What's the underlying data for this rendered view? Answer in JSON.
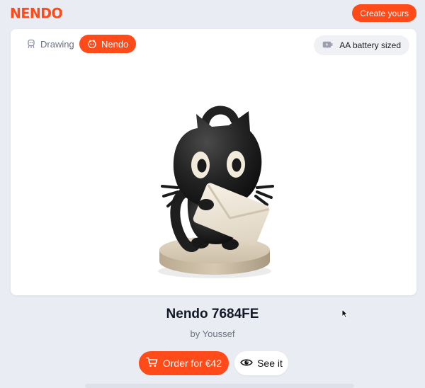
{
  "header": {
    "logo_text": "NENDO",
    "create_label": "Create yours"
  },
  "viewer": {
    "tabs": [
      {
        "label": "Drawing",
        "icon": "drawing-icon",
        "selected": false
      },
      {
        "label": "Nendo",
        "icon": "nendo-icon",
        "selected": true
      }
    ],
    "size_badge": {
      "label": "AA battery sized",
      "icon": "battery-icon"
    },
    "image": {
      "subject": "black-cat-figurine-with-envelope",
      "icon": "figure-image"
    }
  },
  "product": {
    "title": "Nendo 7684FE",
    "byline": "by Youssef"
  },
  "actions": {
    "order_label": "Order for €42",
    "order_icon": "cart-icon",
    "see_label": "See it",
    "see_icon": "eye-icon"
  },
  "colors": {
    "accent": "#ff4a1a",
    "background": "#e9ecf3",
    "card": "#ffffff"
  }
}
